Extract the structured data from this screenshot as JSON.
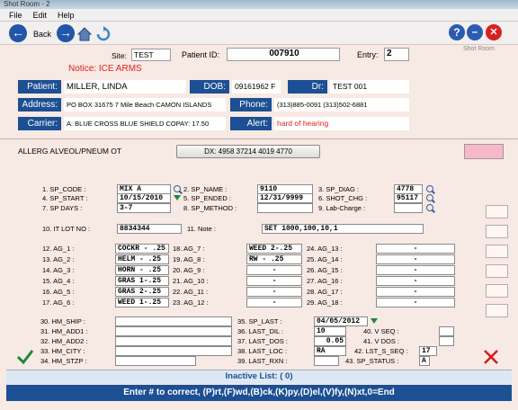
{
  "window": {
    "title": "Shot Room - 2"
  },
  "menu": [
    "File",
    "Edit",
    "Help"
  ],
  "toolbar": {
    "back_label": "Back",
    "app_label": "Shot Room"
  },
  "patient_header": {
    "site_label": "Site:",
    "site": "TEST",
    "patient_id_label": "Patient ID:",
    "patient_id": "007910",
    "entry_label": "Entry:",
    "entry": "2",
    "notice": "Notice: ICE ARMS",
    "patient_label": "Patient:",
    "patient": "MILLER, LINDA",
    "dob_label": "DOB:",
    "dob": "09161962  F",
    "dr_label": "Dr:",
    "dr": "TEST 001",
    "address_label": "Address:",
    "address": "PO BOX 31675 7 Mile Beach CAMON ISLANDS",
    "phone_label": "Phone:",
    "phone": "(313)885-0091 (313)502-6881",
    "carrier_label": "Carrier:",
    "carrier": "A: BLUE CROSS BLUE SHIELD COPAY:  17.50",
    "alert_label": "Alert:",
    "alert": "hard of hearing"
  },
  "allergy": "ALLERG ALVEOL/PNEUM OT",
  "dx_button": "DX: 4958  37214 4019  4770",
  "fields": {
    "sp_code_label": "1. SP_CODE :",
    "sp_code": "MIX A",
    "sp_name_label": "2. SP_NAME :",
    "sp_name": "9110",
    "sp_diag_label": "3. SP_DIAG :",
    "sp_diag": "4778",
    "sp_start_label": "4. SP_START :",
    "sp_start": "10/15/2010",
    "sp_ended_label": "5. SP_ENDED :",
    "sp_ended": "12/31/9999",
    "shot_chg_label": "6. SHOT_CHG :",
    "shot_chg": "95117",
    "sp_days_label": "7. SP DAYS :",
    "sp_days": "3-7",
    "sp_method_label": "8. SP_METHOD :",
    "sp_method": "",
    "lab_charge_label": "9. Lab-Charge :",
    "lab_charge": "",
    "it_lot_label": "10. IT LOT NO :",
    "it_lot": "8834344",
    "note_label": "11. Note :",
    "note": "SET 1000,100,10,1"
  },
  "ag_left": [
    {
      "label": "12. AG_1 :",
      "value": "COCKR - .25"
    },
    {
      "label": "13. AG_2 :",
      "value": "HELM  - .25"
    },
    {
      "label": "14. AG_3 :",
      "value": "HORN  - .25"
    },
    {
      "label": "15. AG_4 :",
      "value": "GRAS 1-.25"
    },
    {
      "label": "16. AG_5 :",
      "value": "GRAS 2-.25"
    },
    {
      "label": "17. AG_6 :",
      "value": "WEED 1-.25"
    }
  ],
  "ag_mid": [
    {
      "label": "18. AG_7 :",
      "value": "WEED 2-.25"
    },
    {
      "label": "19. AG_8 :",
      "value": "RW    - .25"
    },
    {
      "label": "20. AG_9 :",
      "value": "-"
    },
    {
      "label": "21. AG_10 :",
      "value": "-"
    },
    {
      "label": "22. AG_11 :",
      "value": "-"
    },
    {
      "label": "23. AG_12 :",
      "value": "-"
    }
  ],
  "ag_right": [
    {
      "label": "24. AG_13 :",
      "value": "-"
    },
    {
      "label": "25. AG_14 :",
      "value": "-"
    },
    {
      "label": "26. AG_15 :",
      "value": "-"
    },
    {
      "label": "27. AG_16 :",
      "value": "-"
    },
    {
      "label": "28. AG_17 :",
      "value": "-"
    },
    {
      "label": "29. AG_18 :",
      "value": "-"
    }
  ],
  "hm": [
    {
      "label": "30. HM_SHIP :",
      "value": ""
    },
    {
      "label": "31. HM_ADD1 :",
      "value": ""
    },
    {
      "label": "32. HM_ADD2 :",
      "value": ""
    },
    {
      "label": "33. HM_CITY :",
      "value": ""
    },
    {
      "label": "34. HM_STZP :",
      "value": ""
    }
  ],
  "last": [
    {
      "label": "35. SP_LAST :",
      "value": "04/05/2012"
    },
    {
      "label": "36. LAST_DIL :",
      "value": "10"
    },
    {
      "label": "37. LAST_DOS :",
      "value": "0.05"
    },
    {
      "label": "38. LAST_LOC :",
      "value": "RA"
    },
    {
      "label": "39. LAST_RXN :",
      "value": ""
    }
  ],
  "vfields": [
    {
      "label": "40. V SEQ :",
      "value": ""
    },
    {
      "label": "41. V DOS :",
      "value": ""
    },
    {
      "label": "42. LST_S_SEQ :",
      "value": "17"
    },
    {
      "label": "43. SP_STATUS :",
      "value": "A"
    }
  ],
  "inactive": "Inactive List:  ( 0)",
  "command": "Enter # to correct, (P)rt,(F)wd,(B)ck,(K)py,(D)el,(V)fy,(N)xt,0=End",
  "colors": {
    "header_blue": "#1c4f93",
    "notice_red": "#e02020",
    "bg": "#f7e9e3"
  }
}
